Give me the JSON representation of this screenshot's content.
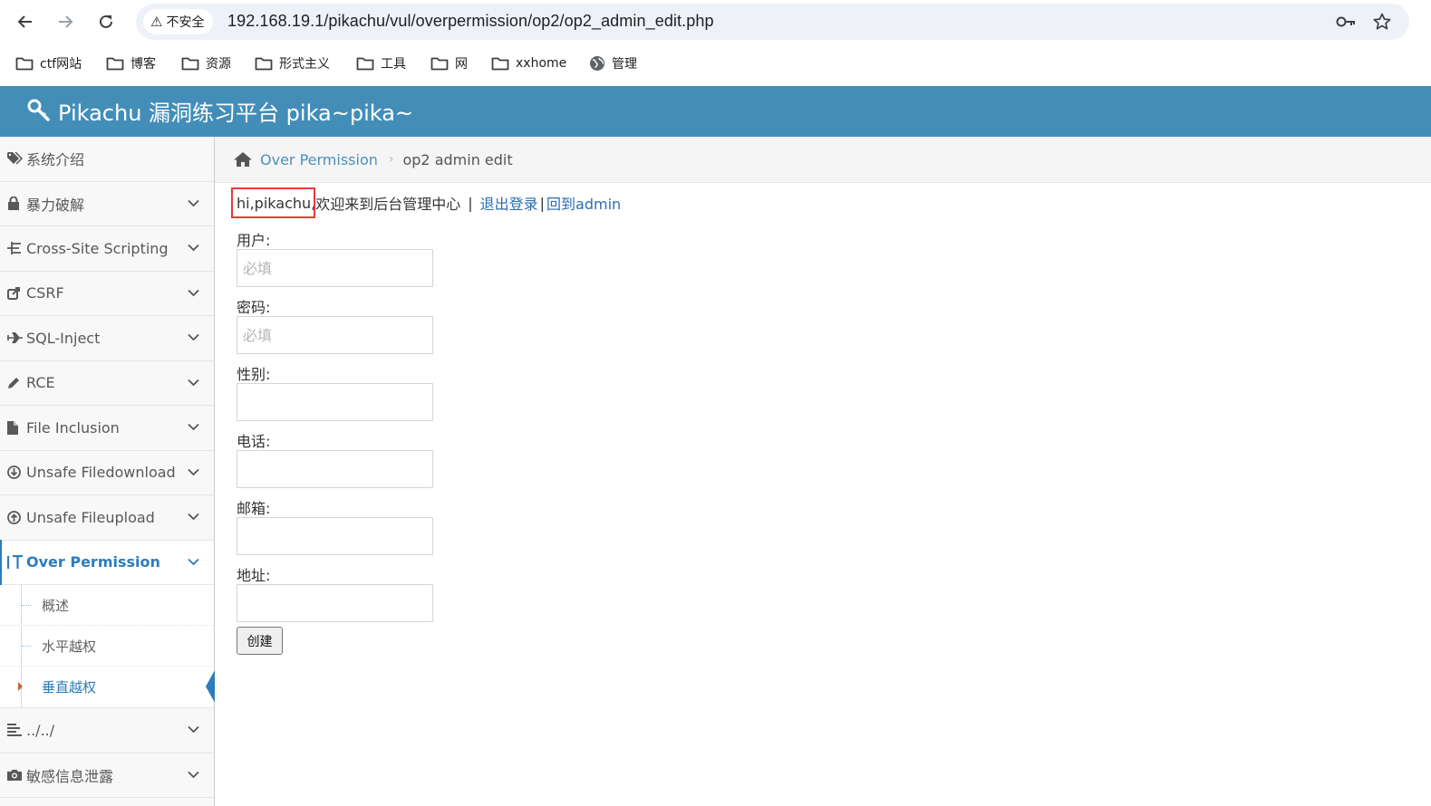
{
  "browser": {
    "security_label": "不安全",
    "url": "192.168.19.1/pikachu/vul/overpermission/op2/op2_admin_edit.php",
    "bookmarks": [
      {
        "label": "ctf网站",
        "icon": "folder-icon"
      },
      {
        "label": "博客",
        "icon": "folder-icon"
      },
      {
        "label": "资源",
        "icon": "folder-icon"
      },
      {
        "label": "形式主义",
        "icon": "folder-icon"
      },
      {
        "label": "工具",
        "icon": "folder-icon"
      },
      {
        "label": "网",
        "icon": "folder-icon"
      },
      {
        "label": "xxhome",
        "icon": "folder-icon"
      },
      {
        "label": "管理",
        "icon": "globe-icon"
      }
    ]
  },
  "header": {
    "title": "Pikachu 漏洞练习平台 pika~pika~",
    "color": "#438eb9"
  },
  "sidebar": {
    "items": [
      {
        "label": "系统介绍",
        "icon": "tags-icon"
      },
      {
        "label": "暴力破解",
        "icon": "lock-icon"
      },
      {
        "label": "Cross-Site Scripting",
        "icon": "sitemap-icon"
      },
      {
        "label": "CSRF",
        "icon": "share-icon"
      },
      {
        "label": "SQL-Inject",
        "icon": "plane-icon"
      },
      {
        "label": "RCE",
        "icon": "pencil-icon"
      },
      {
        "label": "File Inclusion",
        "icon": "file-icon"
      },
      {
        "label": "Unsafe Filedownload",
        "icon": "download-icon"
      },
      {
        "label": "Unsafe Fileupload",
        "icon": "upload-icon"
      },
      {
        "label": "Over Permission",
        "icon": "text-height-icon"
      },
      {
        "label": "../../",
        "icon": "align-left-icon"
      },
      {
        "label": "敏感信息泄露",
        "icon": "camera-icon"
      }
    ],
    "submenu": [
      {
        "label": "概述"
      },
      {
        "label": "水平越权"
      },
      {
        "label": "垂直越权"
      }
    ],
    "accent": "#2b7dbc"
  },
  "breadcrumb": {
    "parent": "Over Permission",
    "current": "op2 admin edit"
  },
  "welcome": {
    "user": "hi,pikachu,",
    "message": "欢迎来到后台管理中心",
    "separator": "|",
    "logout": "退出登录",
    "back": "回到admin"
  },
  "form": {
    "fields": [
      {
        "label": "用户:",
        "placeholder": "必填",
        "value": ""
      },
      {
        "label": "密码:",
        "placeholder": "必填",
        "value": ""
      },
      {
        "label": "性别:",
        "placeholder": "",
        "value": ""
      },
      {
        "label": "电话:",
        "placeholder": "",
        "value": ""
      },
      {
        "label": "邮箱:",
        "placeholder": "",
        "value": ""
      },
      {
        "label": "地址:",
        "placeholder": "",
        "value": ""
      }
    ],
    "submit_label": "创建"
  }
}
